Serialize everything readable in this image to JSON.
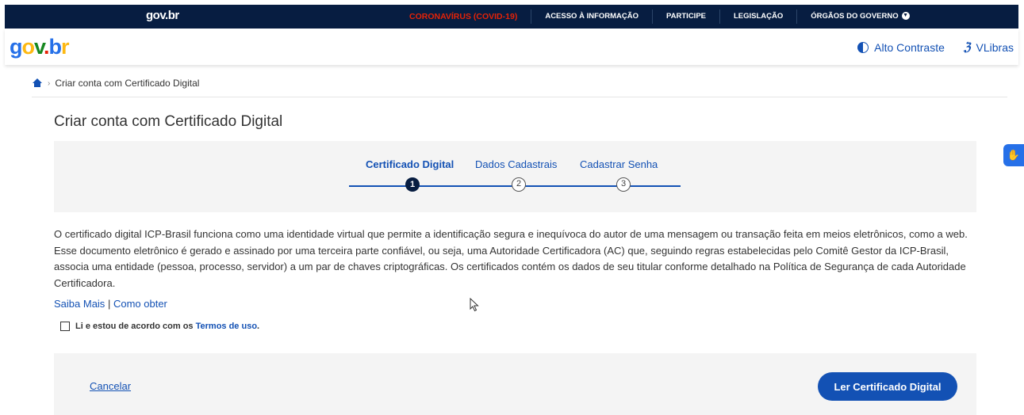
{
  "topbar": {
    "brand": "gov.br",
    "links": [
      {
        "label": "CORONAVÍRUS (COVID-19)",
        "kind": "covid"
      },
      {
        "label": "ACESSO À INFORMAÇÃO"
      },
      {
        "label": "PARTICIPE"
      },
      {
        "label": "LEGISLAÇÃO"
      },
      {
        "label": "ÓRGÃOS DO GOVERNO"
      }
    ],
    "dropdown_icon": "chevron-down-icon"
  },
  "header": {
    "logo": {
      "g": "g",
      "o": "o",
      "v": "v",
      "dot": ".",
      "b": "b",
      "r": "r"
    },
    "contrast_label": "Alto Contraste",
    "libras_label": "VLibras"
  },
  "breadcrumb": {
    "home_icon": "home-icon",
    "current": "Criar conta com Certificado Digital"
  },
  "page": {
    "title": "Criar conta com Certificado Digital"
  },
  "stepper": {
    "steps": [
      {
        "label": "Certificado Digital",
        "number": "1",
        "state": "active"
      },
      {
        "label": "Dados Cadastrais",
        "number": "2",
        "state": "inactive"
      },
      {
        "label": "Cadastrar Senha",
        "number": "3",
        "state": "inactive"
      }
    ]
  },
  "content": {
    "intro": "O certificado digital ICP-Brasil funciona como uma identidade virtual que permite a identificação segura e inequívoca do autor de uma mensagem ou transação feita em meios eletrônicos, como a web. Esse documento eletrônico é gerado e assinado por uma terceira parte confiável, ou seja, uma Autoridade Certificadora (AC) que, seguindo regras estabelecidas pelo Comitê Gestor da ICP-Brasil, associa uma entidade (pessoa, processo, servidor) a um par de chaves criptográficas. Os certificados contém os dados de seu titular conforme detalhado na Política de Segurança de cada Autoridade Certificadora.",
    "link_more": "Saiba Mais",
    "link_sep": "|",
    "link_how": "Como obter",
    "terms_text": "Li e estou de acordo com os",
    "terms_link": "Termos de uso",
    "terms_period": ".",
    "terms_checked": false
  },
  "actions": {
    "cancel_label": "Cancelar",
    "primary_label": "Ler Certificado Digital"
  },
  "colors": {
    "topbar_bg": "#071d41",
    "primary": "#1351b4",
    "covid": "#e52207",
    "panel_bg": "#f4f4f4"
  }
}
